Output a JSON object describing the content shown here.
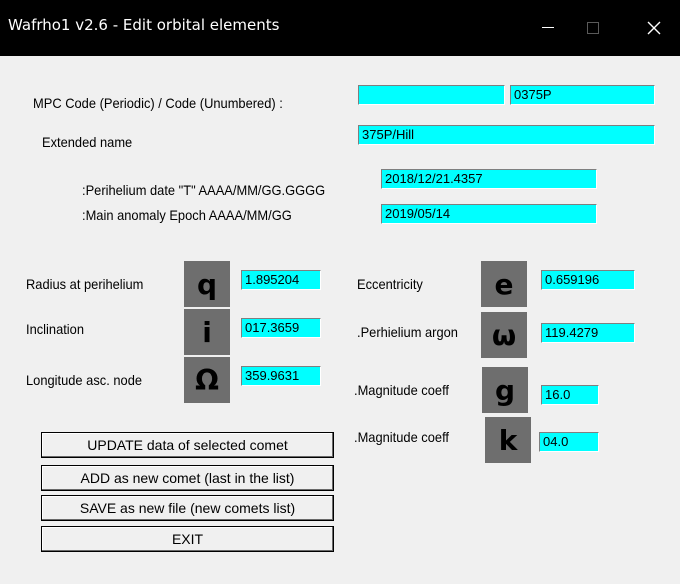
{
  "window": {
    "title": "Wafrho1 v2.6 - Edit orbital elements",
    "minimize_glyph": "—",
    "maximize_glyph": "□",
    "close_glyph": "✕"
  },
  "form": {
    "mpc_label": "MPC Code (Periodic) /  Code (Unumbered) :",
    "mpc_periodic": "",
    "mpc_unnumbered": "0375P",
    "ext_name_label": "Extended name",
    "ext_name": "375P/Hill",
    "perihelion_date_label": ":Perihelium date \"T\"  AAAA/MM/GG.GGGG",
    "perihelion_date": "2018/12/21.4357",
    "main_anomaly_label": ":Main anomaly Epoch AAAA/MM/GG",
    "main_anomaly": "2019/05/14",
    "radius_label": "Radius at perihelium",
    "radius_symbol": "q",
    "radius": "1.895204",
    "inclination_label": "Inclination",
    "inclination_symbol": "i",
    "inclination": "017.3659",
    "longitude_label": "Longitude asc. node",
    "longitude_symbol": "Ω",
    "longitude": "359.9631",
    "eccentricity_label": "Eccentricity",
    "eccentricity_symbol": "e",
    "eccentricity": "0.659196",
    "perihelion_arg_label": ".Perhielium argon",
    "perihelion_arg_symbol": "ω",
    "perihelion_arg": "119.4279",
    "mag_g_label": ".Magnitude coeff",
    "mag_g_symbol": "g",
    "mag_g": "16.0",
    "mag_k_label": ".Magnitude coeff",
    "mag_k_symbol": "k",
    "mag_k": "04.0"
  },
  "buttons": {
    "update": "UPDATE data of selected comet",
    "add": "ADD as new comet (last in the list)",
    "save": "SAVE as new file (new comets list)",
    "exit": "EXIT"
  },
  "colors": {
    "field_bg": "#00ffff",
    "symbol_bg": "#6e6e6e",
    "titlebar_bg": "#000000"
  }
}
